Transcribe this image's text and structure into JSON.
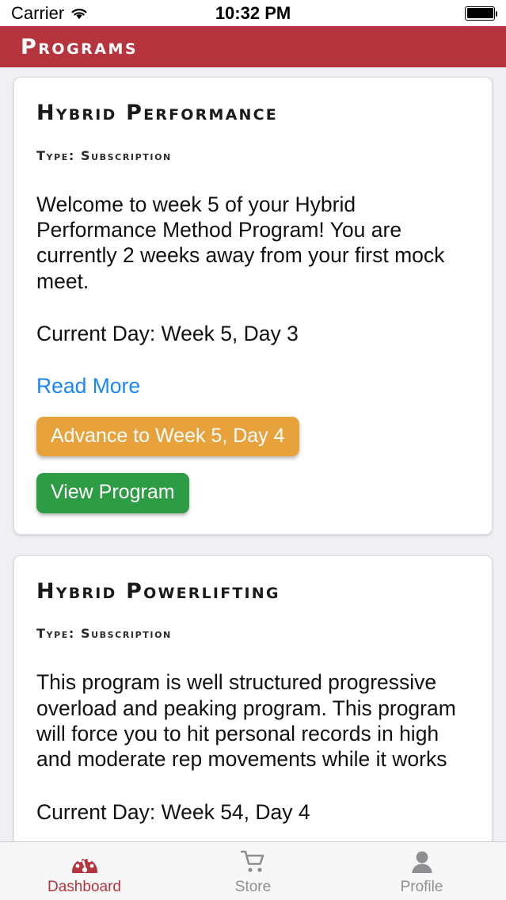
{
  "status_bar": {
    "carrier": "Carrier",
    "wifi_icon": "wifi-icon",
    "time": "10:32 PM",
    "battery_icon": "battery-full-icon"
  },
  "nav": {
    "title": "Programs",
    "background_color": "#b5343e"
  },
  "programs": [
    {
      "title": "Hybrid Performance",
      "type_label": "Type: Subscription",
      "description": "Welcome to week 5 of your Hybrid Performance Method Program! You are currently 2 weeks away from your first mock meet.",
      "current_day": "Current Day: Week 5, Day 3",
      "read_more_label": "Read More",
      "advance_label": "Advance to Week 5, Day 4",
      "view_label": "View Program",
      "advance_color": "#e8a23c",
      "view_color": "#2d9c44",
      "link_color": "#1b86fb"
    },
    {
      "title": "Hybrid Powerlifting",
      "type_label": "Type: Subscription",
      "description": "This program is well structured progressive overload and peaking program. This program will force you to hit personal records in high and moderate rep movements while it works",
      "current_day": "Current Day: Week 54, Day 4"
    }
  ],
  "tab_bar": {
    "items": [
      {
        "label": "Dashboard",
        "icon": "speedometer-icon",
        "active": true,
        "color": "#b5343e"
      },
      {
        "label": "Store",
        "icon": "shopping-cart-icon",
        "active": false,
        "color": "#8e8e93"
      },
      {
        "label": "Profile",
        "icon": "person-icon",
        "active": false,
        "color": "#8e8e93"
      }
    ]
  }
}
